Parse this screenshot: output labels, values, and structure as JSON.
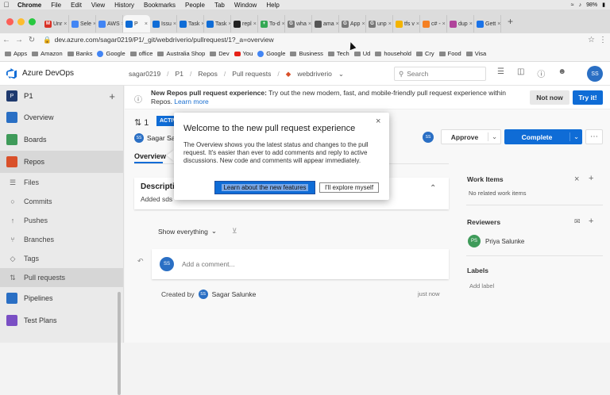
{
  "menubar": {
    "app": "Chrome",
    "items": [
      "File",
      "Edit",
      "View",
      "History",
      "Bookmarks",
      "People",
      "Tab",
      "Window",
      "Help"
    ],
    "battery": "98%"
  },
  "tabs": [
    {
      "label": "Unr",
      "color": "#d93025",
      "glyph": "M"
    },
    {
      "label": "Sele",
      "color": "#4285f4",
      "glyph": ""
    },
    {
      "label": "AWS",
      "color": "#4285f4",
      "glyph": ""
    },
    {
      "label": "P",
      "color": "#0f6cd6",
      "glyph": "",
      "active": true
    },
    {
      "label": "Issu",
      "color": "#0f6cd6",
      "glyph": ""
    },
    {
      "label": "Task",
      "color": "#0f6cd6",
      "glyph": ""
    },
    {
      "label": "Task",
      "color": "#0f6cd6",
      "glyph": ""
    },
    {
      "label": "repl",
      "color": "#222222",
      "glyph": ""
    },
    {
      "label": "To-d",
      "color": "#34a853",
      "glyph": "+"
    },
    {
      "label": "wha",
      "color": "#777777",
      "glyph": "G"
    },
    {
      "label": "ama",
      "color": "#555555",
      "glyph": ""
    },
    {
      "label": "App",
      "color": "#777777",
      "glyph": "G"
    },
    {
      "label": "unp",
      "color": "#777777",
      "glyph": "G"
    },
    {
      "label": "tfs v",
      "color": "#f4b400",
      "glyph": ""
    },
    {
      "label": "c# -",
      "color": "#f48024",
      "glyph": ""
    },
    {
      "label": "dup",
      "color": "#b0449b",
      "glyph": ""
    },
    {
      "label": "Gett",
      "color": "#1a73e8",
      "glyph": ""
    }
  ],
  "address": {
    "url": "dev.azure.com/sagar0219/P1/_git/webdriverio/pullrequest/1?_a=overview"
  },
  "bookmarks": [
    "Apps",
    "Amazon",
    "Banks",
    "Google",
    "office",
    "Australia Shop",
    "Dev",
    "You",
    "Google",
    "Business",
    "Tech",
    "Ud",
    "household",
    "Cry",
    "Food",
    "Visa"
  ],
  "header": {
    "product": "Azure DevOps",
    "breadcrumb": [
      "sagar0219",
      "P1",
      "Repos",
      "Pull requests",
      "webdriverio"
    ],
    "search_placeholder": "Search",
    "user_initials": "SS"
  },
  "sidebar": {
    "project_initial": "P",
    "project_name": "P1",
    "items": [
      {
        "label": "Overview",
        "color": "#2a6fc4",
        "top": true
      },
      {
        "label": "Boards",
        "color": "#3f9b5a",
        "top": true
      },
      {
        "label": "Repos",
        "color": "#d9502a",
        "top": true,
        "repos": true
      },
      {
        "label": "Files",
        "sub": true
      },
      {
        "label": "Commits",
        "sub": true
      },
      {
        "label": "Pushes",
        "sub": true
      },
      {
        "label": "Branches",
        "sub": true
      },
      {
        "label": "Tags",
        "sub": true
      },
      {
        "label": "Pull requests",
        "sub": true,
        "active": true
      },
      {
        "label": "Pipelines",
        "color": "#2a6fc4",
        "top": true
      },
      {
        "label": "Test Plans",
        "color": "#7a4fc4",
        "top": true
      }
    ]
  },
  "banner": {
    "bold": "New Repos pull request experience:",
    "text": " Try out the new modern, fast, and mobile-friendly pull request experience within Repos. ",
    "link": "Learn more",
    "not_now": "Not now",
    "try_it": "Try it!"
  },
  "pr": {
    "id": "1",
    "status": "ACTIVE",
    "author": "Sagar Salunke",
    "author_initials": "SS",
    "tab": "Overview",
    "approve": "Approve",
    "complete": "Complete",
    "description_title": "Description",
    "description_text": "Added sds",
    "filter": "Show everything",
    "comment_placeholder": "Add a comment...",
    "created_by_label": "Created by",
    "created_by": "Sagar Salunke",
    "created_time": "just now"
  },
  "right_panel": {
    "work_items_title": "Work Items",
    "work_items_empty": "No related work items",
    "reviewers_title": "Reviewers",
    "reviewer_name": "Priya Salunke",
    "reviewer_initials": "PS",
    "labels_title": "Labels",
    "add_label": "Add label"
  },
  "popup": {
    "title": "Welcome to the new pull request experience",
    "body": "The Overview shows you the latest status and changes to the pull request. It's easier than ever to add comments and reply to active discussions. New code and comments will appear immediately.",
    "learn_button": "Learn about the new features",
    "explore_button": "I'll explore myself"
  }
}
